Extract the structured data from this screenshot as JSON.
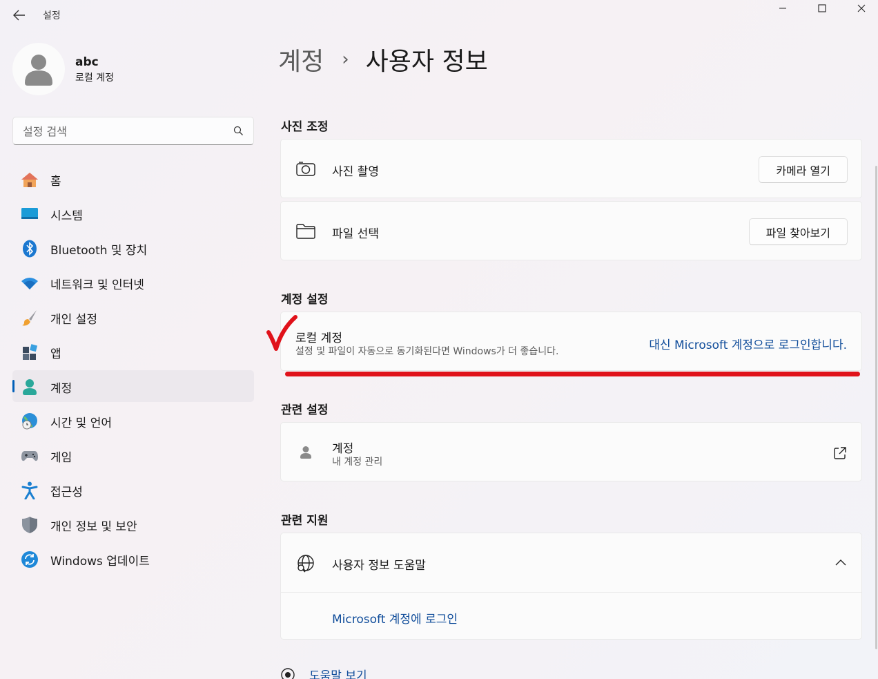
{
  "window": {
    "title": "설정"
  },
  "user": {
    "name": "abc",
    "account_type": "로컬 계정"
  },
  "search": {
    "placeholder": "설정 검색"
  },
  "sidebar": {
    "items": [
      {
        "label": "홈",
        "icon": "home-icon"
      },
      {
        "label": "시스템",
        "icon": "system-icon"
      },
      {
        "label": "Bluetooth 및 장치",
        "icon": "bluetooth-icon"
      },
      {
        "label": "네트워크 및 인터넷",
        "icon": "wifi-icon"
      },
      {
        "label": "개인 설정",
        "icon": "brush-icon"
      },
      {
        "label": "앱",
        "icon": "apps-icon"
      },
      {
        "label": "계정",
        "icon": "account-icon",
        "active": true
      },
      {
        "label": "시간 및 언어",
        "icon": "globe-clock-icon"
      },
      {
        "label": "게임",
        "icon": "gamepad-icon"
      },
      {
        "label": "접근성",
        "icon": "accessibility-icon"
      },
      {
        "label": "개인 정보 및 보안",
        "icon": "shield-icon"
      },
      {
        "label": "Windows 업데이트",
        "icon": "update-icon"
      }
    ]
  },
  "breadcrumb": {
    "parent": "계정",
    "separator": "›",
    "current": "사용자 정보"
  },
  "photo_section": {
    "title": "사진 조정",
    "take_photo": {
      "label": "사진 촬영",
      "button": "카메라 열기"
    },
    "choose_file": {
      "label": "파일 선택",
      "button": "파일 찾아보기"
    }
  },
  "account_section": {
    "title": "계정 설정",
    "local_account": {
      "title": "로컬 계정",
      "description": "설정 및 파일이 자동으로 동기화된다면 Windows가 더 좋습니다.",
      "link": "대신 Microsoft 계정으로 로그인합니다."
    }
  },
  "related_settings": {
    "title": "관련 설정",
    "accounts": {
      "title": "계정",
      "subtitle": "내 계정 관리"
    }
  },
  "related_support": {
    "title": "관련 지원",
    "help": {
      "title": "사용자 정보 도움말",
      "link": "Microsoft 계정에 로그인"
    }
  },
  "footer": {
    "help_link": "도움말 보기"
  },
  "colors": {
    "accent": "#005fb8",
    "link": "#0f4c9a",
    "annotation_red": "#e0121a"
  }
}
